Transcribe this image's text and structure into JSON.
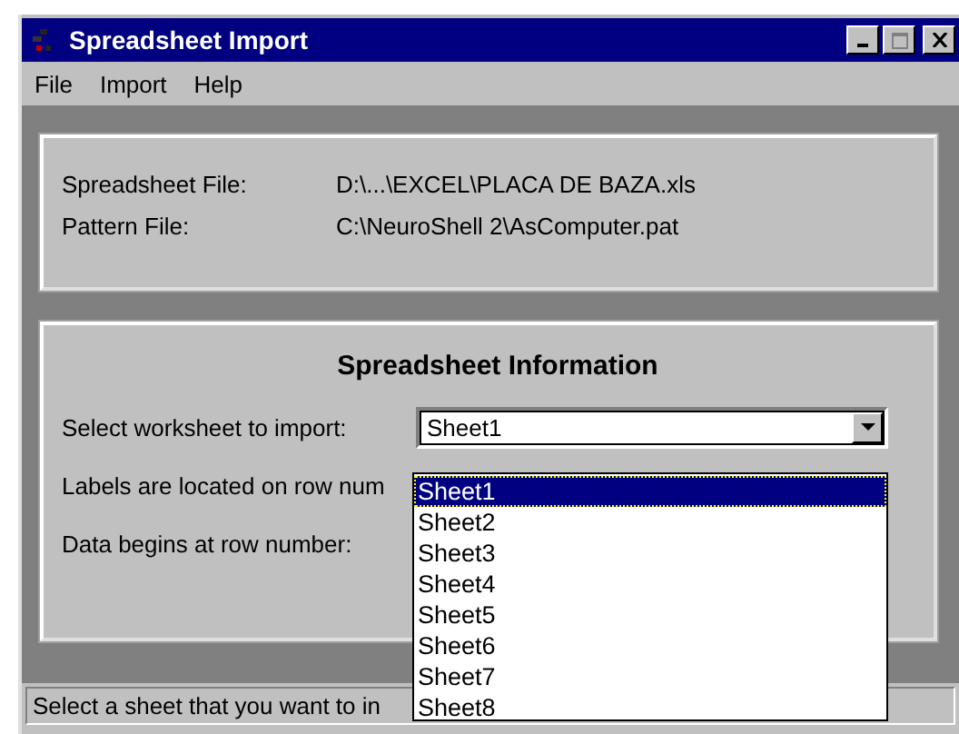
{
  "window": {
    "title": "Spreadsheet Import"
  },
  "menu": [
    {
      "label": "File"
    },
    {
      "label": "Import"
    },
    {
      "label": "Help"
    }
  ],
  "files": [
    {
      "label": "Spreadsheet  File:",
      "value": "D:\\...\\EXCEL\\PLACA DE BAZA.xls"
    },
    {
      "label": "Pattern File:",
      "value": "C:\\NeuroShell 2\\AsComputer.pat"
    }
  ],
  "info": {
    "title": "Spreadsheet Information",
    "worksheet": {
      "label": "Select worksheet to import:",
      "value": "Sheet1",
      "expanded": true,
      "options": [
        {
          "label": "Sheet1",
          "selected": true
        },
        {
          "label": "Sheet2",
          "selected": false
        },
        {
          "label": "Sheet3",
          "selected": false
        },
        {
          "label": "Sheet4",
          "selected": false
        },
        {
          "label": "Sheet5",
          "selected": false
        },
        {
          "label": "Sheet6",
          "selected": false
        },
        {
          "label": "Sheet7",
          "selected": false
        },
        {
          "label": "Sheet8",
          "selected": false
        }
      ]
    },
    "rows": [
      {
        "label": "Labels are located on row num"
      },
      {
        "label": "Data begins at row number:"
      }
    ]
  },
  "status_bar": "Select a sheet that you want to in"
}
